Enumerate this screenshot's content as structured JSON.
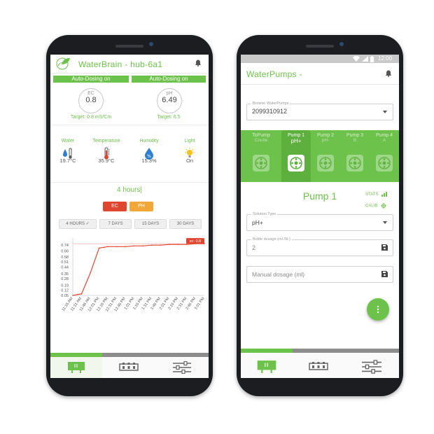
{
  "phone1": {
    "title": "WaterBrain - hub-6a1",
    "auto_dosing_left": "Auto-Dosing on",
    "auto_dosing_right": "Auto-Dosing on",
    "ec": {
      "label": "EC",
      "value": "0.8",
      "target": "Target: 0.8 mS/Cm"
    },
    "ph": {
      "label": "pH",
      "value": "6.49",
      "target": "Target: 6.5"
    },
    "sensors": [
      {
        "name": "Water",
        "value": "19.7°C",
        "icon": "water-thermometer-icon"
      },
      {
        "name": "Temperature",
        "value": "35.9°C",
        "icon": "thermometer-icon"
      },
      {
        "name": "Humidity",
        "value": "15.3%",
        "icon": "humidity-drop-icon"
      },
      {
        "name": "Light",
        "value": "On",
        "icon": "light-bulb-icon"
      }
    ],
    "range_value": "4 hours",
    "ec_button": "EC",
    "ph_button": "PH",
    "day_buttons": [
      "4 HOURS ✓",
      "7 DAYS",
      "15 DAYS",
      "30 DAYS"
    ],
    "colors": {
      "accent": "#6cc24a",
      "ec": "#e0452f",
      "ph": "#f2a838"
    }
  },
  "chart_data": {
    "type": "line",
    "title": "",
    "xlabel": "",
    "ylabel": "",
    "categories": [
      "11:16 AM",
      "11:31 AM",
      "11:46 AM",
      "12:01 PM",
      "12:16 PM",
      "12:31 PM",
      "12:46 PM",
      "1:01 PM",
      "1:16 PM",
      "1:31 PM",
      "1:46 PM",
      "2:01 PM",
      "2:16 PM",
      "2:31 PM",
      "2:46 PM",
      "3:01 PM"
    ],
    "y_ticks": [
      0.05,
      0.12,
      0.19,
      0.28,
      0.35,
      0.44,
      0.51,
      0.58,
      0.66,
      0.74
    ],
    "ylim": [
      0.05,
      0.8
    ],
    "series": [
      {
        "name": "ec",
        "marker_label": "ec: 0.8",
        "color": "#e0452f",
        "values": [
          0.05,
          0.07,
          0.36,
          0.7,
          0.72,
          0.72,
          0.72,
          0.73,
          0.73,
          0.74,
          0.74,
          0.75,
          0.75,
          0.75,
          0.76,
          0.76
        ]
      }
    ],
    "target_line": 0.76,
    "grid": false
  },
  "phone2": {
    "status_time": "12:00",
    "title": "WaterPumps -",
    "browse_label": "Browse WaterPumps",
    "browse_value": "2099310912",
    "pumps": [
      {
        "name": "ToPump",
        "type": "Coutie"
      },
      {
        "name": "Pump 1",
        "type": "pH+"
      },
      {
        "name": "Pump 2",
        "type": "pH-"
      },
      {
        "name": "Pump 3",
        "type": "B"
      },
      {
        "name": "Pump 4",
        "type": "A"
      }
    ],
    "selected_pump": "Pump 1",
    "stats_label": "STATS",
    "calib_label": "CALIB",
    "solution_label": "Solution Type",
    "solution_value": "pH+",
    "bottle_label": "Bottle dosage (ml /0L)",
    "bottle_value": "2",
    "manual_placeholder": "Manual dosage (ml)",
    "fab_icon": "more-vert-icon"
  }
}
